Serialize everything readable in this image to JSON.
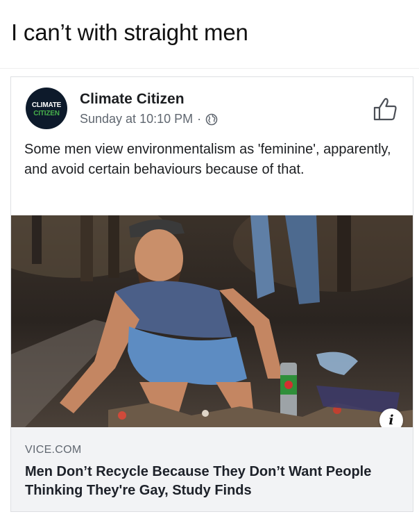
{
  "caption": "I can’t with straight men",
  "post": {
    "avatar_line1": "CLIMATE",
    "avatar_line2": "CITIZEN",
    "page_name": "Climate Citizen",
    "timestamp": "Sunday at 10:10 PM",
    "separator": "·",
    "privacy_icon": "globe-icon",
    "like_icon": "thumbs-up-icon",
    "text": "Some men view environmentalism as 'feminine', apparently, and avoid certain behaviours because of that."
  },
  "link": {
    "info_icon": "i",
    "domain": "VICE.COM",
    "headline": "Men Don’t Recycle Because They Don’t Want People Thinking They're Gay, Study Finds"
  },
  "colors": {
    "accent_green": "#47b04b",
    "meta_gray": "#606770",
    "link_bg": "#f2f3f5"
  }
}
